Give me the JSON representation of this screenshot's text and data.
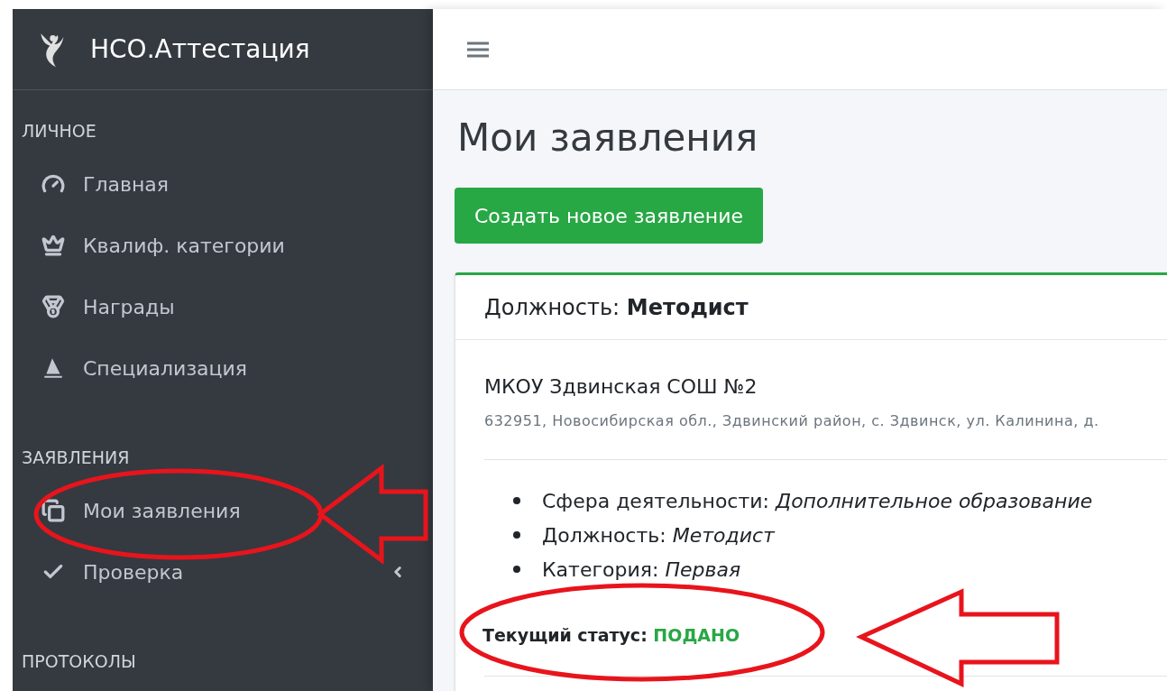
{
  "sidebar": {
    "brand": "НСО.Аттестация",
    "sections": [
      {
        "title": "ЛИЧНОЕ",
        "items": [
          {
            "label": "Главная",
            "kind": "link"
          },
          {
            "label": "Квалиф. категории",
            "kind": "link"
          },
          {
            "label": "Награды",
            "kind": "link"
          },
          {
            "label": "Специализация",
            "kind": "link"
          }
        ]
      },
      {
        "title": "ЗАЯВЛЕНИЯ",
        "items": [
          {
            "label": "Мои заявления",
            "kind": "link"
          },
          {
            "label": "Проверка",
            "kind": "submenu",
            "expanded": false
          }
        ]
      },
      {
        "title": "ПРОТОКОЛЫ"
      }
    ]
  },
  "page": {
    "title": "Мои заявления",
    "create_button": "Создать новое заявление",
    "card": {
      "header_label": "Должность:",
      "header_value": "Методист",
      "organization": "МКОУ Здвинская СОШ №2",
      "address": "632951, Новосибирская обл., Здвинский район, с. Здвинск, ул. Калинина, д.",
      "details": [
        {
          "label": "Сфера деятельности:",
          "value": "Дополнительное образование"
        },
        {
          "label": "Должность:",
          "value": "Методист"
        },
        {
          "label": "Категория:",
          "value": "Первая"
        }
      ],
      "status_label": "Текущий статус:",
      "status_value": "ПОДАНО"
    }
  }
}
